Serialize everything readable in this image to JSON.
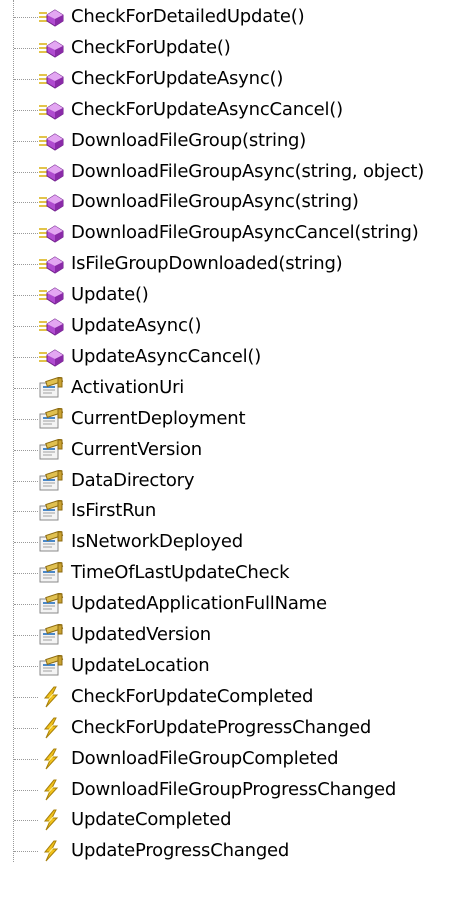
{
  "tree": {
    "items": [
      {
        "label": "CheckForDetailedUpdate()",
        "kind": "method",
        "icon": "method-icon"
      },
      {
        "label": "CheckForUpdate()",
        "kind": "method",
        "icon": "method-icon"
      },
      {
        "label": "CheckForUpdateAsync()",
        "kind": "method",
        "icon": "method-icon"
      },
      {
        "label": "CheckForUpdateAsyncCancel()",
        "kind": "method",
        "icon": "method-icon"
      },
      {
        "label": "DownloadFileGroup(string)",
        "kind": "method",
        "icon": "method-icon"
      },
      {
        "label": "DownloadFileGroupAsync(string, object)",
        "kind": "method",
        "icon": "method-icon"
      },
      {
        "label": "DownloadFileGroupAsync(string)",
        "kind": "method",
        "icon": "method-icon"
      },
      {
        "label": "DownloadFileGroupAsyncCancel(string)",
        "kind": "method",
        "icon": "method-icon"
      },
      {
        "label": "IsFileGroupDownloaded(string)",
        "kind": "method",
        "icon": "method-icon"
      },
      {
        "label": "Update()",
        "kind": "method",
        "icon": "method-icon"
      },
      {
        "label": "UpdateAsync()",
        "kind": "method",
        "icon": "method-icon"
      },
      {
        "label": "UpdateAsyncCancel()",
        "kind": "method",
        "icon": "method-icon"
      },
      {
        "label": "ActivationUri",
        "kind": "property",
        "icon": "property-icon"
      },
      {
        "label": "CurrentDeployment",
        "kind": "property",
        "icon": "property-icon"
      },
      {
        "label": "CurrentVersion",
        "kind": "property",
        "icon": "property-icon"
      },
      {
        "label": "DataDirectory",
        "kind": "property",
        "icon": "property-icon"
      },
      {
        "label": "IsFirstRun",
        "kind": "property",
        "icon": "property-icon"
      },
      {
        "label": "IsNetworkDeployed",
        "kind": "property",
        "icon": "property-icon"
      },
      {
        "label": "TimeOfLastUpdateCheck",
        "kind": "property",
        "icon": "property-icon"
      },
      {
        "label": "UpdatedApplicationFullName",
        "kind": "property",
        "icon": "property-icon"
      },
      {
        "label": "UpdatedVersion",
        "kind": "property",
        "icon": "property-icon"
      },
      {
        "label": "UpdateLocation",
        "kind": "property",
        "icon": "property-icon"
      },
      {
        "label": "CheckForUpdateCompleted",
        "kind": "event",
        "icon": "event-icon"
      },
      {
        "label": "CheckForUpdateProgressChanged",
        "kind": "event",
        "icon": "event-icon"
      },
      {
        "label": "DownloadFileGroupCompleted",
        "kind": "event",
        "icon": "event-icon"
      },
      {
        "label": "DownloadFileGroupProgressChanged",
        "kind": "event",
        "icon": "event-icon"
      },
      {
        "label": "UpdateCompleted",
        "kind": "event",
        "icon": "event-icon"
      },
      {
        "label": "UpdateProgressChanged",
        "kind": "event",
        "icon": "event-icon"
      }
    ]
  },
  "colors": {
    "method_purple": "#b04bd0",
    "method_lines": "#e2c44a",
    "property_gold": "#e0c050",
    "event_yellow": "#f2c21a",
    "connector": "#9a9a9a"
  }
}
